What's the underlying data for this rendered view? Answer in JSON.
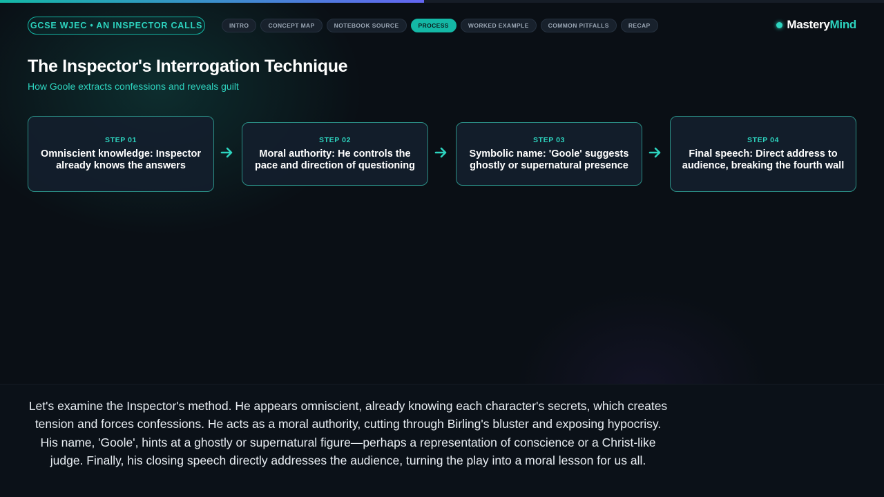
{
  "progress": {
    "fraction": 0.48
  },
  "course": {
    "label": "GCSE WJEC • AN INSPECTOR CALLS"
  },
  "nav": {
    "tabs": [
      {
        "label": "INTRO",
        "active": false
      },
      {
        "label": "CONCEPT MAP",
        "active": false
      },
      {
        "label": "NOTEBOOK SOURCE",
        "active": false
      },
      {
        "label": "PROCESS",
        "active": true
      },
      {
        "label": "WORKED EXAMPLE",
        "active": false
      },
      {
        "label": "COMMON PITFALLS",
        "active": false
      },
      {
        "label": "RECAP",
        "active": false
      }
    ]
  },
  "brand": {
    "part1": "Mastery",
    "part2": "Mind",
    "accent": "#2dd4bf"
  },
  "header": {
    "title": "The Inspector's Interrogation Technique",
    "subtitle": "How Goole extracts confessions and reveals guilt"
  },
  "steps": [
    {
      "label": "STEP 01",
      "text": "Omniscient knowledge: Inspector already knows the answers"
    },
    {
      "label": "STEP 02",
      "text": "Moral authority: He controls the pace and direction of questioning"
    },
    {
      "label": "STEP 03",
      "text": "Symbolic name: 'Goole' suggests ghostly or supernatural presence"
    },
    {
      "label": "STEP 04",
      "text": "Final speech: Direct address to audience, breaking the fourth wall"
    }
  ],
  "icons": {
    "step_arrow": "arrow-right-icon",
    "brand_dot": "dot-icon"
  },
  "caption": {
    "text": "Let's examine the Inspector's method. He appears omniscient, already knowing each character's secrets, which creates tension and forces confessions. He acts as a moral authority, cutting through Birling's bluster and exposing hypocrisy. His name, 'Goole', hints at a ghostly or supernatural figure—perhaps a representation of conscience or a Christ-like judge. Finally, his closing speech directly addresses the audience, turning the play into a moral lesson for us all."
  }
}
